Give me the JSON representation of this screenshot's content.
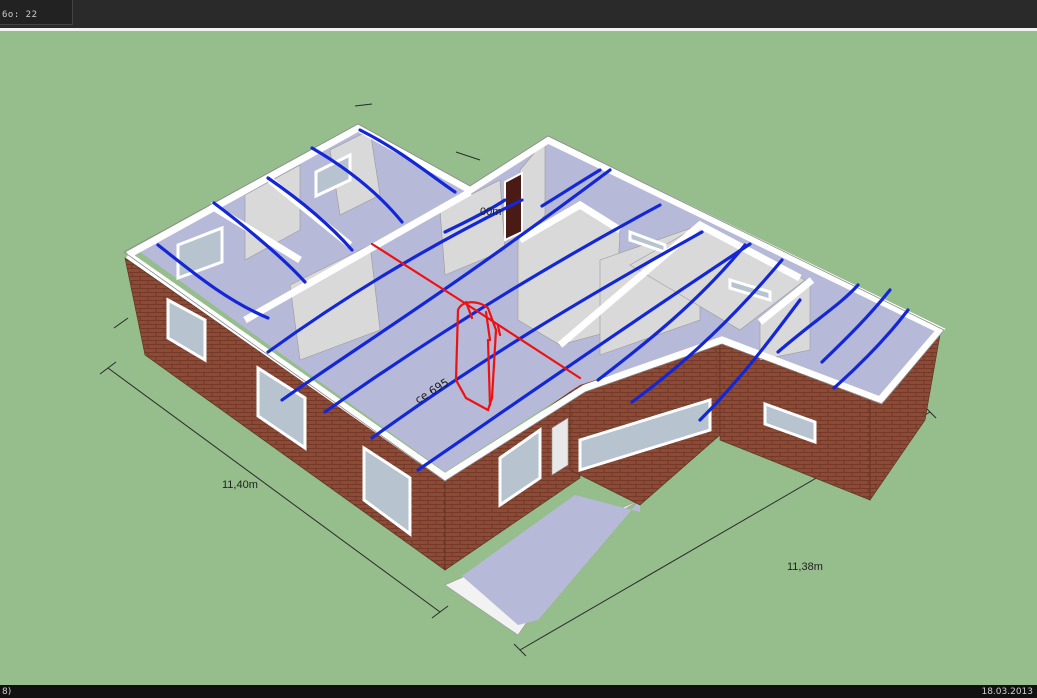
{
  "toolbar": {
    "field_label": "6o: 22"
  },
  "drawing": {
    "dimension_front": "11,40m",
    "dimension_right": "11,38m",
    "dimension_inner": "00m",
    "annotation_handwritten": "ce 695"
  },
  "status": {
    "left_text": "8)",
    "date": "18.03.2013"
  },
  "colors": {
    "ground": "#96bd8c",
    "brick": "#8e4a35",
    "wall_top": "#ffffff",
    "floor": "#b7b9d8",
    "heating_pipes": "#1327d6",
    "boiler_lines": "#ee1111"
  }
}
